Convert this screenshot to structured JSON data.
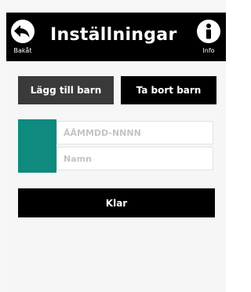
{
  "header": {
    "title": "Inställningar",
    "back_label": "Bakåt",
    "info_label": "Info",
    "back_icon": "arrow-back-icon",
    "info_icon": "info-icon"
  },
  "tabs": {
    "add_label": "Lägg till barn",
    "remove_label": "Ta bort barn"
  },
  "child_form": {
    "color": "#0e8a7e",
    "id_placeholder": "ÅÅMMDD-NNNN",
    "id_value": "",
    "name_placeholder": "Namn",
    "name_value": ""
  },
  "done_label": "Klar",
  "colors": {
    "header_bg": "#000000",
    "add_tab_bg": "#3a3a3a",
    "remove_tab_bg": "#000000",
    "accent": "#0e8a7e"
  }
}
